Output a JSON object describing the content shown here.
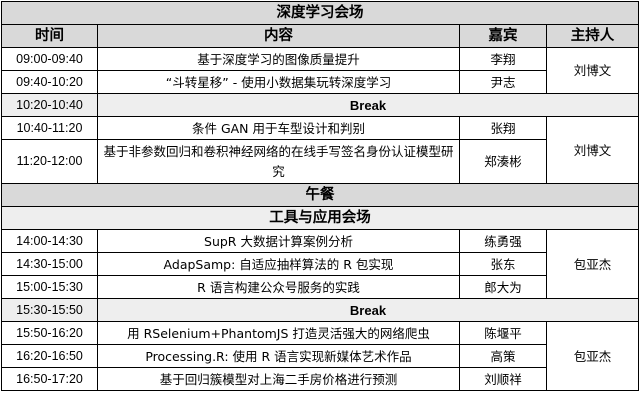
{
  "session1": {
    "title": "深度学习会场",
    "headers": {
      "time": "时间",
      "content": "内容",
      "speaker": "嘉宾",
      "host": "主持人"
    },
    "host_a": "刘博文",
    "host_b": "刘博文",
    "rows": [
      {
        "time": "09:00-09:40",
        "content": "基于深度学习的图像质量提升",
        "speaker": "李翔"
      },
      {
        "time": "09:40-10:20",
        "content": "“斗转星移” - 使用小数据集玩转深度学习",
        "speaker": "尹志"
      },
      {
        "time": "10:20-10:40",
        "break": "Break"
      },
      {
        "time": "10:40-11:20",
        "content": "条件 GAN 用于车型设计和判别",
        "speaker": "张翔"
      },
      {
        "time": "11:20-12:00",
        "content": "基于非参数回归和卷积神经网络的在线手写签名身份认证模型研究",
        "speaker": "郑湊彬"
      }
    ]
  },
  "lunch": "午餐",
  "session2": {
    "title": "工具与应用会场",
    "host_a": "包亚杰",
    "host_b": "包亚杰",
    "rows": [
      {
        "time": "14:00-14:30",
        "content": "SupR 大数据计算案例分析",
        "speaker": "练勇强"
      },
      {
        "time": "14:30-15:00",
        "content": "AdapSamp: 自适应抽样算法的 R 包实现",
        "speaker": "张东"
      },
      {
        "time": "15:00-15:30",
        "content": "R 语言构建公众号服务的实践",
        "speaker": "郎大为"
      },
      {
        "time": "15:30-15:50",
        "break": "Break"
      },
      {
        "time": "15:50-16:20",
        "content": "用 RSelenium+PhantomJS 打造灵活强大的网络爬虫",
        "speaker": "陈堰平"
      },
      {
        "time": "16:20-16:50",
        "content": "Processing.R: 使用 R 语言实现新媒体艺术作品",
        "speaker": "高策"
      },
      {
        "time": "16:50-17:20",
        "content": "基于回归簇模型对上海二手房价格进行预测",
        "speaker": "刘顺祥"
      }
    ]
  }
}
